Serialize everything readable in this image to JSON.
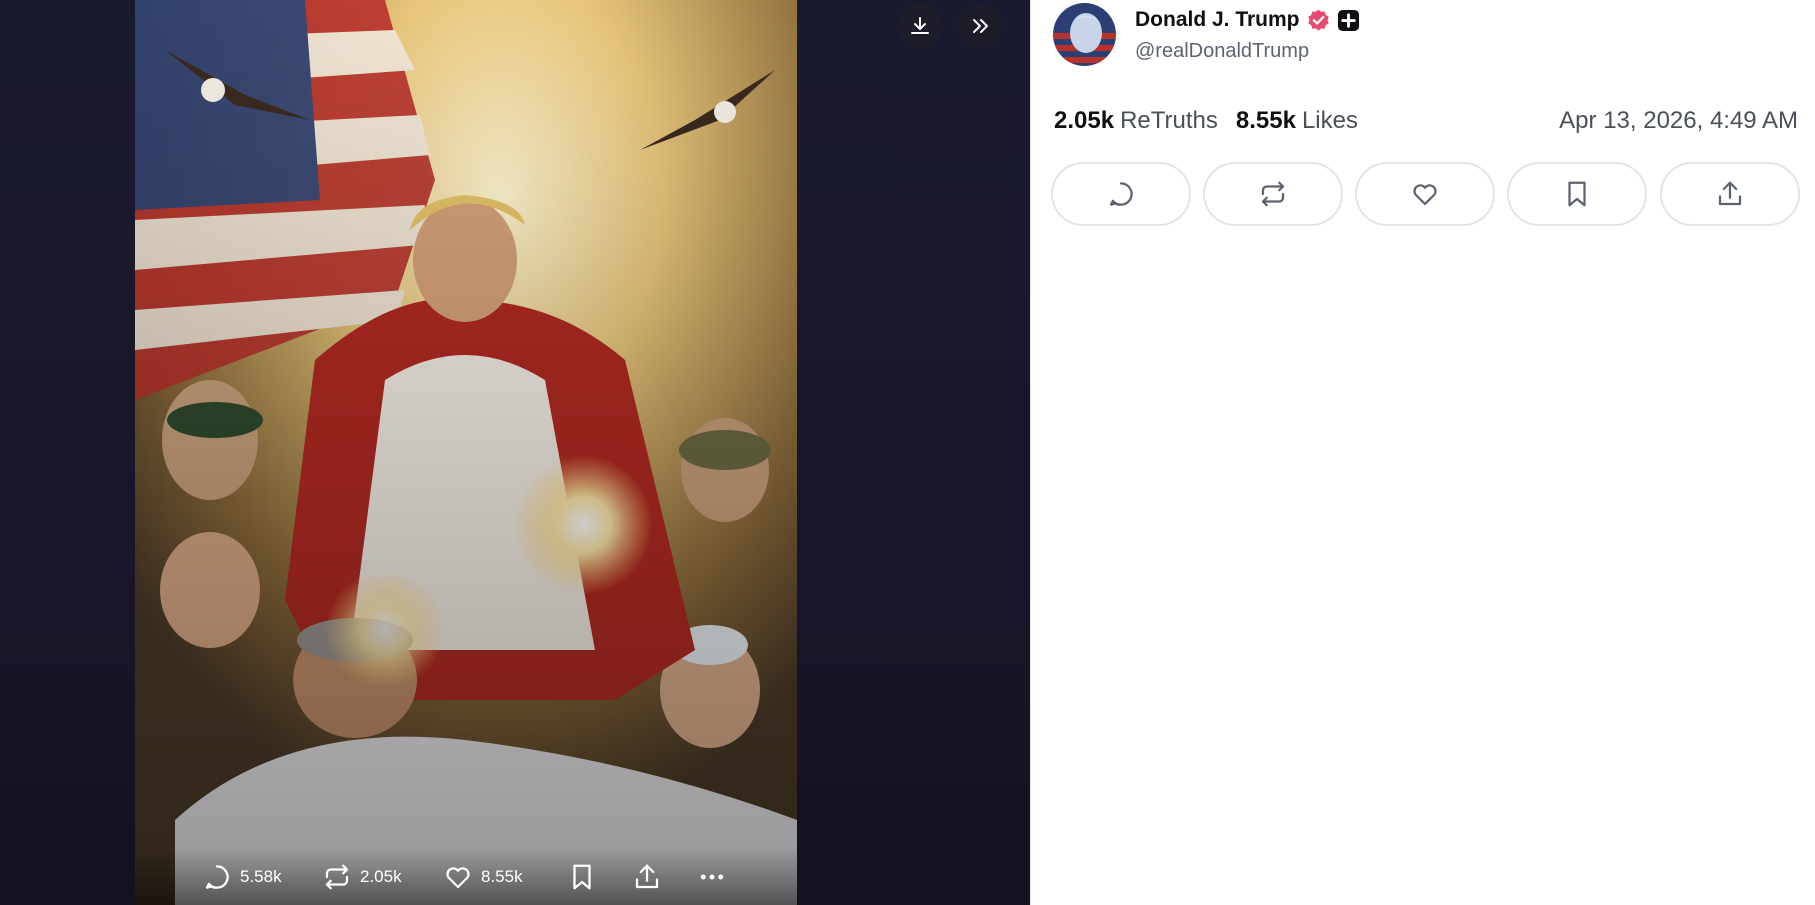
{
  "viewer": {
    "media_alt": "Post image",
    "top_buttons": [
      "download-icon",
      "chevrons-right-icon"
    ],
    "actions": {
      "replies": "5.58k",
      "retruths": "2.05k",
      "likes": "8.55k"
    }
  },
  "post": {
    "author": {
      "name": "Donald J. Trump",
      "handle": "@realDonaldTrump",
      "verified_icon": "verified-badge-icon",
      "plus_icon": "plus-badge-icon"
    },
    "stats": {
      "retruths_count": "2.05k",
      "retruths_label": "ReTruths",
      "likes_count": "8.55k",
      "likes_label": "Likes"
    },
    "timestamp": "Apr 13, 2026, 4:49 AM",
    "action_buttons": [
      "reply-icon",
      "retruth-icon",
      "like-icon",
      "bookmark-icon",
      "share-icon"
    ]
  },
  "colors": {
    "viewer_bg": "#1a1a2e",
    "badge_pink": "#e84b6f",
    "text_dark": "#0f0f14",
    "text_muted": "#5d6272"
  }
}
